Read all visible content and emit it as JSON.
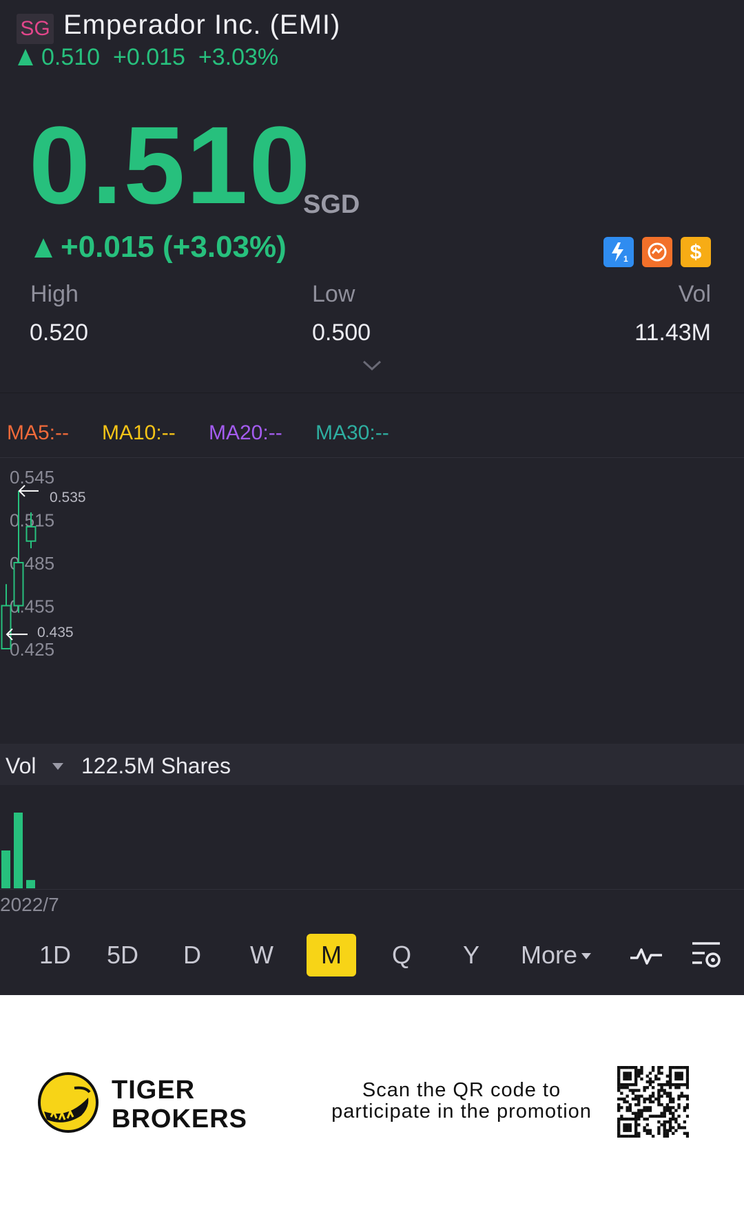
{
  "header": {
    "market_badge": "SG",
    "title": "Emperador Inc. (EMI)",
    "price": "0.510",
    "change": "+0.015",
    "change_pct": "+3.03%"
  },
  "quote": {
    "price": "0.510",
    "currency": "SGD",
    "change_line": "+0.015 (+3.03%)",
    "stats": {
      "high_label": "High",
      "high_value": "0.520",
      "low_label": "Low",
      "low_value": "0.500",
      "vol_label": "Vol",
      "vol_value": "11.43M"
    },
    "badge_icons": [
      "lightning-1-icon",
      "swap-icon",
      "dollar-icon"
    ]
  },
  "indicators": {
    "ma5": "MA5:--",
    "ma10": "MA10:--",
    "ma20": "MA20:--",
    "ma30": "MA30:--"
  },
  "chart_data": {
    "type": "candlestick",
    "y_ticks": [
      "0.545",
      "0.515",
      "0.485",
      "0.455",
      "0.425"
    ],
    "ylim": [
      0.425,
      0.545
    ],
    "max_marker": "0.535",
    "min_marker": "0.435",
    "candles": [
      {
        "open": 0.455,
        "close": 0.425,
        "high": 0.47,
        "low": 0.425
      },
      {
        "open": 0.455,
        "close": 0.485,
        "high": 0.535,
        "low": 0.45
      },
      {
        "open": 0.5,
        "close": 0.51,
        "high": 0.52,
        "low": 0.495
      }
    ],
    "volume": {
      "label": "Vol",
      "value": "122.5M Shares",
      "bars": [
        50,
        100,
        11
      ]
    },
    "x_label": "2022/7"
  },
  "periods": [
    "1D",
    "5D",
    "D",
    "W",
    "M",
    "Q",
    "Y",
    "More"
  ],
  "active_period": "M",
  "footer": {
    "brand_line1": "TIGER",
    "brand_line2": "BROKERS",
    "promo_line1": "Scan the QR code to",
    "promo_line2": "participate in the promotion"
  },
  "colors": {
    "up": "#27c07d",
    "background": "#23232b",
    "ma5": "#f06a3a",
    "ma10": "#f7c417",
    "ma20": "#a45cf0",
    "ma30": "#2eaea0",
    "active_period": "#f7d417"
  }
}
